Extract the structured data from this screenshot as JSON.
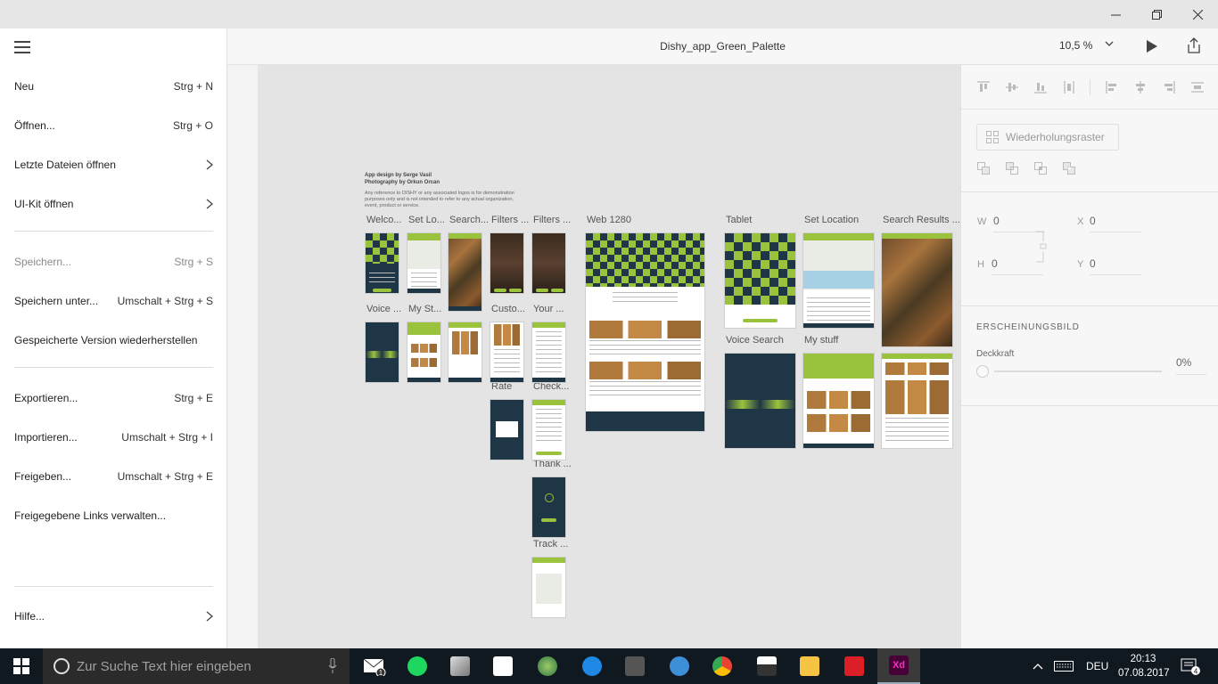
{
  "window": {
    "title": "Dishy_app_Green_Palette",
    "zoom": "10,5 %",
    "controls": [
      "minimize",
      "restore",
      "close"
    ]
  },
  "menu": {
    "items": [
      {
        "label": "Neu",
        "shortcut": "Strg + N",
        "disabled": false,
        "submenu": false
      },
      {
        "label": "Öffnen...",
        "shortcut": "Strg + O",
        "disabled": false,
        "submenu": false
      },
      {
        "label": "Letzte Dateien öffnen",
        "shortcut": "",
        "disabled": false,
        "submenu": true
      },
      {
        "label": "UI-Kit öffnen",
        "shortcut": "",
        "disabled": false,
        "submenu": true
      },
      {
        "label": "Speichern...",
        "shortcut": "Strg + S",
        "disabled": true,
        "submenu": false
      },
      {
        "label": "Speichern unter...",
        "shortcut": "Umschalt + Strg + S",
        "disabled": false,
        "submenu": false
      },
      {
        "label": "Gespeicherte Version wiederherstellen",
        "shortcut": "",
        "disabled": false,
        "submenu": false
      },
      {
        "label": "Exportieren...",
        "shortcut": "Strg + E",
        "disabled": false,
        "submenu": false
      },
      {
        "label": "Importieren...",
        "shortcut": "Umschalt + Strg + I",
        "disabled": false,
        "submenu": false
      },
      {
        "label": "Freigeben...",
        "shortcut": "Umschalt + Strg + E",
        "disabled": false,
        "submenu": false
      },
      {
        "label": "Freigegebene Links verwalten...",
        "shortcut": "",
        "disabled": false,
        "submenu": false
      },
      {
        "label": "Hilfe...",
        "shortcut": "",
        "disabled": false,
        "submenu": true
      }
    ]
  },
  "canvas": {
    "credit_line1": "App design by Serge Vasil",
    "credit_line2": "Photography by Orkun Orcan",
    "credit_note": "Any reference to DISHY or any associated logos is for demonstration purposes only and is not intended to refer to any actual organization, event, product or service.",
    "artboards": [
      "Welco...",
      "Set Lo...",
      "Search...",
      "Filters ...",
      "Filters ...",
      "Voice ...",
      "My St...",
      "Custo...",
      "Your ...",
      "Rate",
      "Check...",
      "Thank ...",
      "Track ...",
      "Web 1280",
      "Tablet",
      "Set Location",
      "Search Results ...",
      "Voice Search",
      "My stuff"
    ]
  },
  "properties": {
    "repeat_grid_label": "Wiederholungsraster",
    "w_label": "W",
    "w_value": "0",
    "h_label": "H",
    "h_value": "0",
    "x_label": "X",
    "x_value": "0",
    "y_label": "Y",
    "y_value": "0",
    "appearance_title": "ERSCHEINUNGSBILD",
    "opacity_label": "Deckkraft",
    "opacity_value": "0%"
  },
  "taskbar": {
    "search_placeholder": "Zur Suche Text hier eingeben",
    "mail_badge": "1",
    "language": "DEU",
    "time": "20:13",
    "date": "07.08.2017",
    "notification_count": "4",
    "apps": [
      "mail",
      "spotify",
      "app",
      "store",
      "globe",
      "edge",
      "cat",
      "thunderbird",
      "chrome",
      "photos",
      "explorer",
      "creative-cloud",
      "adobe-xd"
    ]
  },
  "colors": {
    "accent_green": "#9bc23c",
    "dark_navy": "#1f3646",
    "xd_pink": "#ff2bc2",
    "xd_bg": "#470137"
  }
}
